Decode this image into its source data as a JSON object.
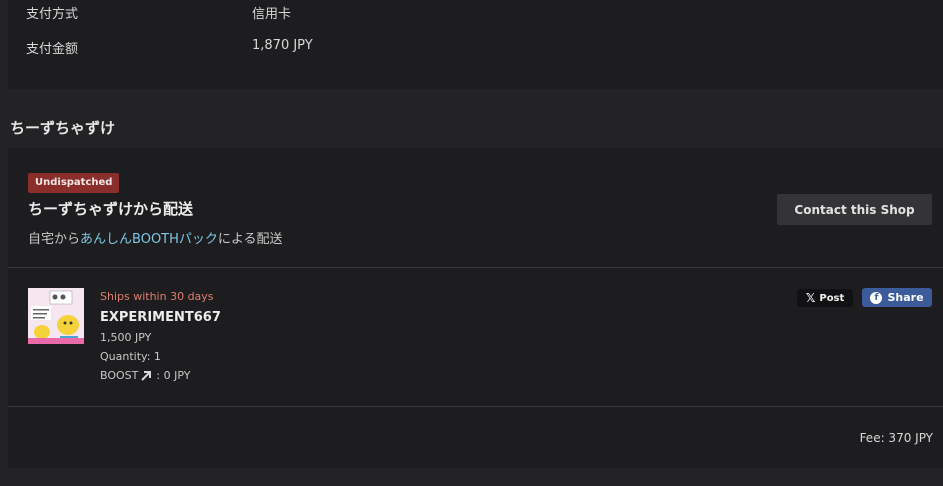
{
  "payment": {
    "method_label": "支付方式",
    "method_value": "信用卡",
    "amount_label": "支付金额",
    "amount_value": "1,870 JPY"
  },
  "shop": {
    "name": "ちーずちゃずけ"
  },
  "order": {
    "status_badge": "Undispatched",
    "ship_from": "ちーずちゃずけから配送",
    "ship_method_prefix": "自宅から",
    "ship_method_link": "あんしんBOOTHパック",
    "ship_method_suffix": "による配送",
    "contact_button": "Contact this Shop",
    "fee": "Fee: 370 JPY"
  },
  "item": {
    "ships_within": "Ships within 30 days",
    "title": "EXPERIMENT667",
    "price": "1,500 JPY",
    "quantity": "Quantity: 1",
    "boost_label": "BOOST",
    "boost_value": ": 0 JPY",
    "thumbnail_icon": "product-thumbnail"
  },
  "share": {
    "x_label": "Post",
    "fb_label": "Share"
  },
  "colors": {
    "badge": "#8a2e2b",
    "link": "#7fc6e4",
    "ships_within": "#e07d6e",
    "facebook": "#3b5b9a"
  }
}
